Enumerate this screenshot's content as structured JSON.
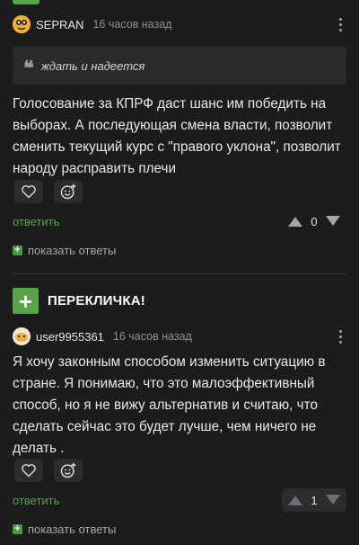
{
  "comment1": {
    "author": "SEPRAN",
    "time": "16 часов назад",
    "quote": "ждать и надеется",
    "text": "Голосование за КПРФ даст шанс им победить на выборах. А последующая смена власти, позволит сменить текущий курс с \"правого уклона\", позволит народу расправить плечи",
    "reply_label": "ответить",
    "vote_count": "0",
    "show_replies_label": "показать ответы"
  },
  "section": {
    "title": "ПЕРЕКЛИЧКА!"
  },
  "comment2": {
    "author": "user9955361",
    "time": "16 часов назад",
    "text": "Я хочу законным способом изменить ситуацию в стране. Я понимаю, что это малоэффективный способ, но я не вижу альтернатив и считаю, что сделать сейчас это будет лучше, чем ничего не делать .",
    "reply_label": "ответить",
    "vote_count": "1",
    "show_replies_label": "показать ответы"
  },
  "colors": {
    "accent": "#5aa34a",
    "background": "#1c1c1e"
  },
  "icons": [
    "quote-icon",
    "heart-icon",
    "emoji-add-icon",
    "upvote-icon",
    "downvote-icon",
    "kebab-menu-icon",
    "plus-icon"
  ]
}
